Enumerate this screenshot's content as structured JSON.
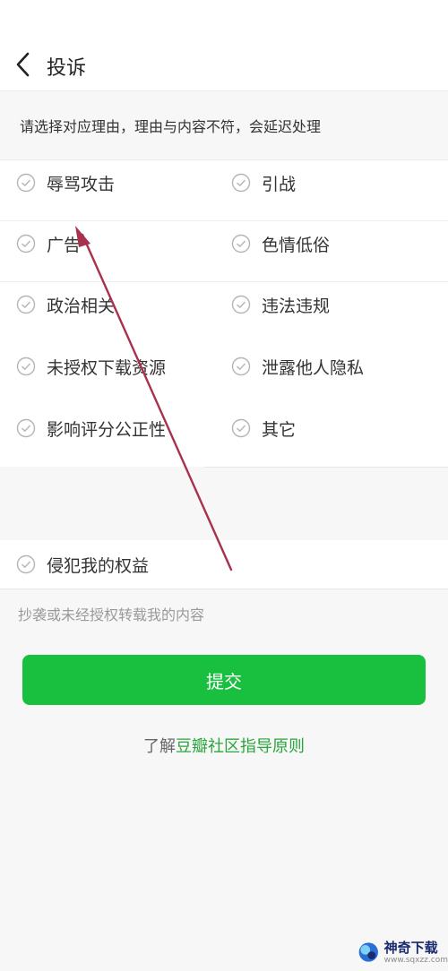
{
  "header": {
    "title": "投诉"
  },
  "instruction": "请选择对应理由，理由与内容不符，会延迟处理",
  "reasons": [
    [
      "辱骂攻击",
      "引战"
    ],
    [
      "广告",
      "色情低俗"
    ],
    [
      "政治相关",
      "违法违规"
    ],
    [
      "未授权下载资源",
      "泄露他人隐私"
    ],
    [
      "影响评分公正性",
      "其它"
    ]
  ],
  "rights": {
    "label": "侵犯我的权益",
    "description": "抄袭或未经授权转载我的内容"
  },
  "submit_label": "提交",
  "guide": {
    "prefix": "了解",
    "link": "豆瓣社区指导原则"
  },
  "watermark": {
    "name": "神奇下载",
    "url": "www.sqxzz.com"
  },
  "colors": {
    "accent": "#19bf3f",
    "link": "#2aa53e",
    "annotation_arrow": "#a8324e",
    "check_circle": "#b5b5b5"
  }
}
